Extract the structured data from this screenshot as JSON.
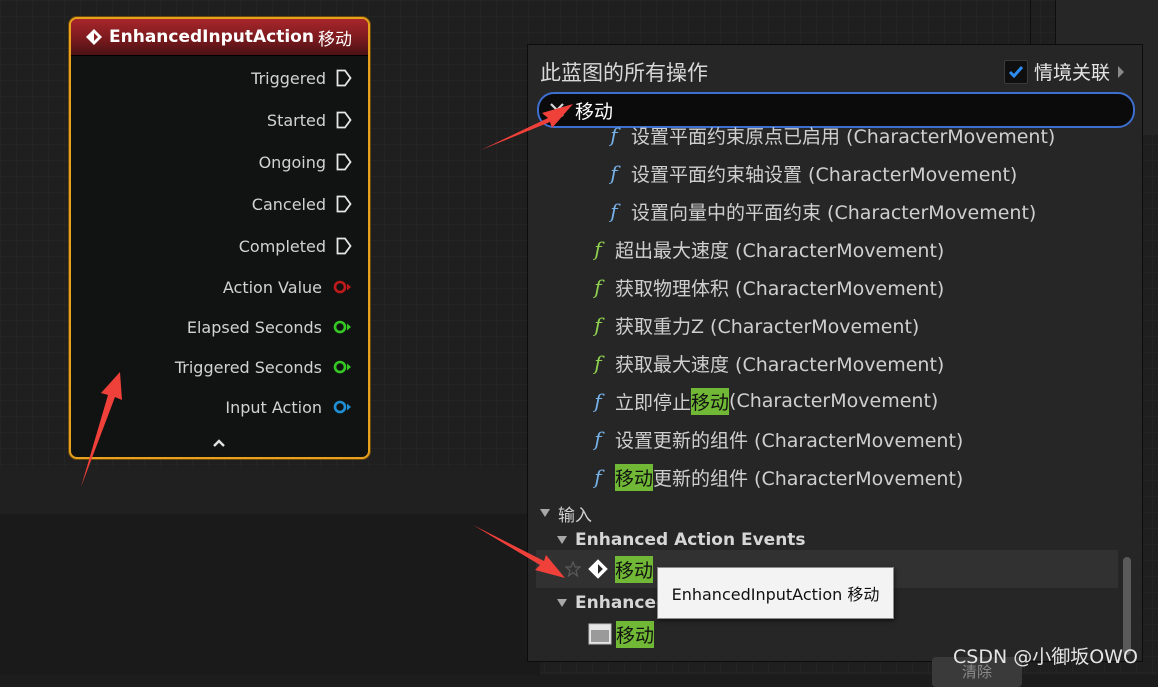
{
  "node": {
    "title": "EnhancedInputAction",
    "title_cn": "移动",
    "pins": [
      {
        "label": "Triggered",
        "kind": "exec"
      },
      {
        "label": "Started",
        "kind": "exec"
      },
      {
        "label": "Ongoing",
        "kind": "exec"
      },
      {
        "label": "Canceled",
        "kind": "exec"
      },
      {
        "label": "Completed",
        "kind": "exec"
      },
      {
        "label": "Action Value",
        "kind": "data",
        "color": "#c01a1a"
      },
      {
        "label": "Elapsed Seconds",
        "kind": "data",
        "color": "#35c825"
      },
      {
        "label": "Triggered Seconds",
        "kind": "data",
        "color": "#35c825"
      },
      {
        "label": "Input Action",
        "kind": "data",
        "color": "#1f8fd6"
      }
    ],
    "header_color": "#a8262b",
    "border_color": "#e8a11c",
    "collapse_icon": "chevron-up-icon"
  },
  "menu": {
    "title": "此蓝图的所有操作",
    "context_label": "情境关联",
    "context_checked": true,
    "search_value": "移动",
    "items": [
      {
        "pre": "",
        "hl": "",
        "post": "设置平面约束原点已启用 (CharacterMovement)",
        "icon": "function-icon",
        "icon_color": "#76b1e8"
      },
      {
        "pre": "",
        "hl": "",
        "post": "设置平面约束轴设置 (CharacterMovement)",
        "icon": "function-icon",
        "icon_color": "#76b1e8"
      },
      {
        "pre": "",
        "hl": "",
        "post": "设置向量中的平面约束 (CharacterMovement)",
        "icon": "function-icon",
        "icon_color": "#76b1e8"
      },
      {
        "pre": "",
        "hl": "",
        "post": "超出最大速度 (CharacterMovement)",
        "icon": "function-icon",
        "icon_color": "#8fd14f"
      },
      {
        "pre": "",
        "hl": "",
        "post": "获取物理体积 (CharacterMovement)",
        "icon": "function-icon",
        "icon_color": "#8fd14f"
      },
      {
        "pre": "",
        "hl": "",
        "post": "获取重力Z (CharacterMovement)",
        "icon": "function-icon",
        "icon_color": "#8fd14f"
      },
      {
        "pre": "",
        "hl": "",
        "post": "获取最大速度 (CharacterMovement)",
        "icon": "function-icon",
        "icon_color": "#8fd14f"
      },
      {
        "pre": "立即停止",
        "hl": "移动",
        "post": " (CharacterMovement)",
        "icon": "function-icon",
        "icon_color": "#76b1e8"
      },
      {
        "pre": "",
        "hl": "",
        "post": "设置更新的组件 (CharacterMovement)",
        "icon": "function-icon",
        "icon_color": "#76b1e8"
      },
      {
        "pre": "",
        "hl": "移动",
        "post": "更新的组件 (CharacterMovement)",
        "icon": "function-icon",
        "icon_color": "#76b1e8"
      }
    ],
    "category_input": "输入",
    "category_enhanced_events": "Enhanced Action Events",
    "event_item": "移动",
    "category_enhanced_2": "Enhanced",
    "asset_item": "移动",
    "clear_label": "清除"
  },
  "tooltip": {
    "text": "EnhancedInputAction 移动"
  },
  "watermark": "CSDN @小御坂OWO",
  "colors": {
    "accent": "#3c6fd0",
    "highlight": "#70b835",
    "arrow": "#f0403a"
  }
}
